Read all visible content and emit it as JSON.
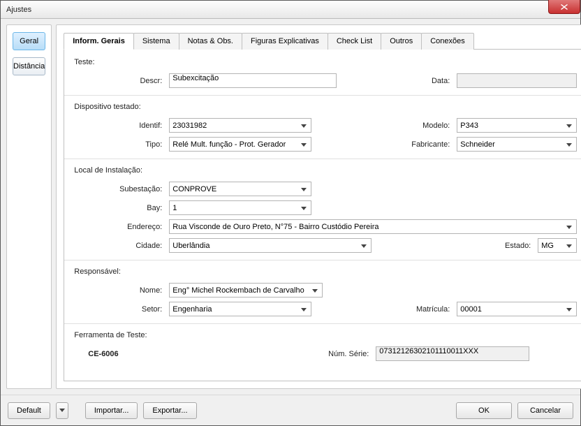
{
  "window": {
    "title": "Ajustes"
  },
  "sidebar": {
    "geral": "Geral",
    "distancia": "Distância"
  },
  "tabs": {
    "inform_gerais": "Inform. Gerais",
    "sistema": "Sistema",
    "notas_obs": "Notas & Obs.",
    "figuras": "Figuras Explicativas",
    "check_list": "Check List",
    "outros": "Outros",
    "conexoes": "Conexões"
  },
  "teste": {
    "section": "Teste:",
    "descr_label": "Descr:",
    "descr_value": "Subexcitação",
    "data_label": "Data:",
    "data_value": ""
  },
  "dispositivo": {
    "section": "Dispositivo testado:",
    "identif_label": "Identif:",
    "identif_value": "23031982",
    "modelo_label": "Modelo:",
    "modelo_value": "P343",
    "tipo_label": "Tipo:",
    "tipo_value": "Relé Mult. função - Prot. Gerador",
    "fabricante_label": "Fabricante:",
    "fabricante_value": "Schneider"
  },
  "local": {
    "section": "Local de Instalação:",
    "subestacao_label": "Subestação:",
    "subestacao_value": "CONPROVE",
    "bay_label": "Bay:",
    "bay_value": "1",
    "endereco_label": "Endereço:",
    "endereco_value": "Rua Visconde de Ouro Preto, N°75 - Bairro Custódio Pereira",
    "cidade_label": "Cidade:",
    "cidade_value": "Uberlândia",
    "estado_label": "Estado:",
    "estado_value": "MG"
  },
  "responsavel": {
    "section": "Responsável:",
    "nome_label": "Nome:",
    "nome_value": "Eng° Michel Rockembach de Carvalho",
    "setor_label": "Setor:",
    "setor_value": "Engenharia",
    "matricula_label": "Matrícula:",
    "matricula_value": "00001"
  },
  "ferramenta": {
    "section": "Ferramenta de Teste:",
    "nome": "CE-6006",
    "num_serie_label": "Núm. Série:",
    "num_serie_value": "07312126302101110011XXX"
  },
  "footer": {
    "default": "Default",
    "importar": "Importar...",
    "exportar": "Exportar...",
    "ok": "OK",
    "cancelar": "Cancelar"
  }
}
